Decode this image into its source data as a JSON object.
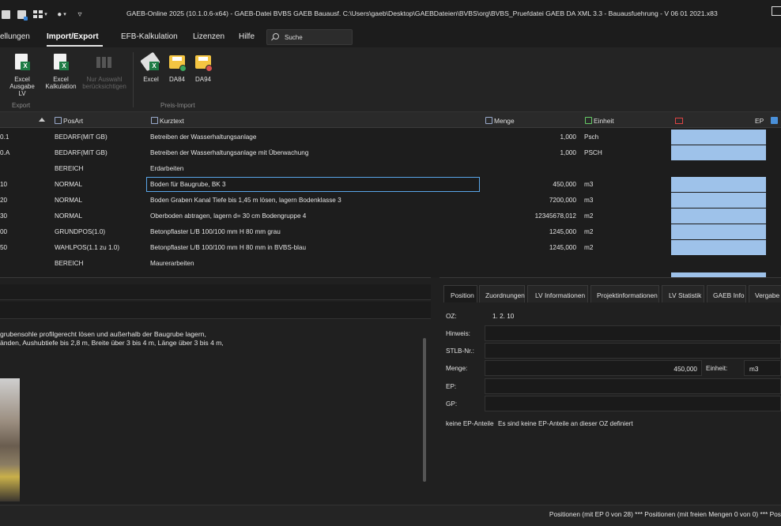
{
  "window": {
    "title": "GAEB-Online 2025 (10.1.0.6-x64) - GAEB-Datei  BVBS GAEB Bauausf. C:\\Users\\gaeb\\Desktop\\GAEBDateien\\BVBS\\org\\BVBS_Pruefdatei GAEB DA XML 3.3 - Bauausfuehrung - V 06 01 2021.x83"
  },
  "menu": {
    "items": [
      "ellungen",
      "Import/Export",
      "EFB-Kalkulation",
      "Lizenzen",
      "Hilfe"
    ],
    "active": "Import/Export",
    "search_label": "Suche"
  },
  "ribbon": {
    "export_group": "Export",
    "preis_import_group": "Preis-Import",
    "buttons": [
      {
        "label1": "Excel",
        "label2": "Ausgabe LV"
      },
      {
        "label1": "Excel",
        "label2": "Kalkulation"
      },
      {
        "label1": "Nur Auswahl",
        "label2": "berücksichtigen"
      },
      {
        "label1": "Excel",
        "label2": ""
      },
      {
        "label1": "DA84",
        "label2": ""
      },
      {
        "label1": "DA94",
        "label2": ""
      }
    ]
  },
  "grid": {
    "headers": {
      "posart": "PosArt",
      "kurztext": "Kurztext",
      "menge": "Menge",
      "einheit": "Einheit",
      "ep": "EP"
    },
    "rows": [
      {
        "oz": "0.1",
        "posart": "BEDARF(MIT GB)",
        "kurztext": "Betreiben der Wasserhaltungsanlage",
        "menge": "1,000",
        "einheit": "Psch",
        "ep": true
      },
      {
        "oz": "0.A",
        "posart": "BEDARF(MIT GB)",
        "kurztext": "Betreiben der Wasserhaltungsanlage mit Überwachung",
        "menge": "1,000",
        "einheit": "PSCH",
        "ep": true
      },
      {
        "oz": "",
        "posart": "BEREICH",
        "kurztext": "Erdarbeiten",
        "menge": "",
        "einheit": "",
        "ep": false
      },
      {
        "oz": "10",
        "posart": "NORMAL",
        "kurztext": "Boden für Baugrube, BK 3",
        "menge": "450,000",
        "einheit": "m3",
        "ep": true,
        "selected": true
      },
      {
        "oz": "20",
        "posart": "NORMAL",
        "kurztext": "Boden Graben Kanal Tiefe bis 1,45 m lösen, lagern Bodenklasse 3",
        "menge": "7200,000",
        "einheit": "m3",
        "ep": true
      },
      {
        "oz": "30",
        "posart": "NORMAL",
        "kurztext": "Oberboden abtragen, lagern d= 30 cm Bodengruppe 4",
        "menge": "12345678,012",
        "einheit": "m2",
        "ep": true
      },
      {
        "oz": "00",
        "posart": "GRUNDPOS(1.0)",
        "kurztext": "Betonpflaster L/B 100/100 mm H 80 mm  grau",
        "menge": "1245,000",
        "einheit": "m2",
        "ep": true
      },
      {
        "oz": "50",
        "posart": "WAHLPOS(1.1 zu 1.0)",
        "kurztext": "Betonpflaster L/B 100/100 mm H 80 mm  in BVBS-blau",
        "menge": "1245,000",
        "einheit": "m2",
        "ep": true
      },
      {
        "oz": "",
        "posart": "BEREICH",
        "kurztext": "Maurerarbeiten",
        "menge": "",
        "einheit": "",
        "ep": false
      }
    ]
  },
  "langtext": {
    "line1": "grubensohle profilgerecht lösen und außerhalb der Baugrube lagern,",
    "line2": "änden, Aushubtiefe bis 2,8 m, Breite über 3 bis 4 m, Länge über 3 bis 4 m,"
  },
  "detail": {
    "tabs": [
      "Position",
      "Zuordnungen",
      "LV Informationen",
      "Projektinformationen",
      "LV Statistik",
      "GAEB Info",
      "Vergabe I"
    ],
    "active_tab": "Position",
    "oz_label": "OZ:",
    "oz_value": "1.  2.  10",
    "hinweis_label": "Hinweis:",
    "stlb_label": "STLB-Nr.:",
    "menge_label": "Menge:",
    "menge_value": "450,000",
    "einheit_label": "Einheit:",
    "einheit_value": "m3",
    "ep_label": "EP:",
    "gp_label": "GP:",
    "ep_anteile_label": "keine EP-Anteile",
    "ep_anteile_text": "Es sind keine EP-Anteile an dieser OZ definiert"
  },
  "status": {
    "text": "Positionen (mit EP 0 von 28) *** Positionen (mit freien Mengen 0 von 0) *** Pos"
  },
  "colors": {
    "ep_fill": "#9ec2ea",
    "selection_border": "#5aa6e8",
    "excel_green": "#1e7b45",
    "folder_yellow": "#f4c542"
  }
}
